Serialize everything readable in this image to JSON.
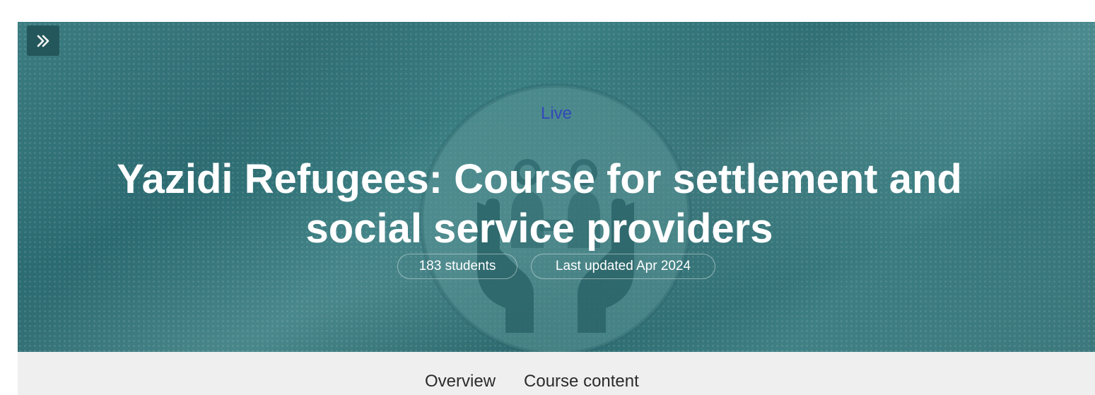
{
  "hero": {
    "expand_icon": "double-chevron-right-icon",
    "emblem_icon": "hands-holding-people-icon",
    "status_label": "Live",
    "title": "Yazidi Refugees: Course for settlement and social service providers",
    "badges": {
      "students": "183 students",
      "last_updated": "Last updated Apr 2024"
    },
    "colors": {
      "hero_background": "#2d6e73",
      "status_text": "#3348b8",
      "expand_button": "#24575b"
    }
  },
  "tabs": [
    {
      "label": "Overview"
    },
    {
      "label": "Course content"
    }
  ]
}
